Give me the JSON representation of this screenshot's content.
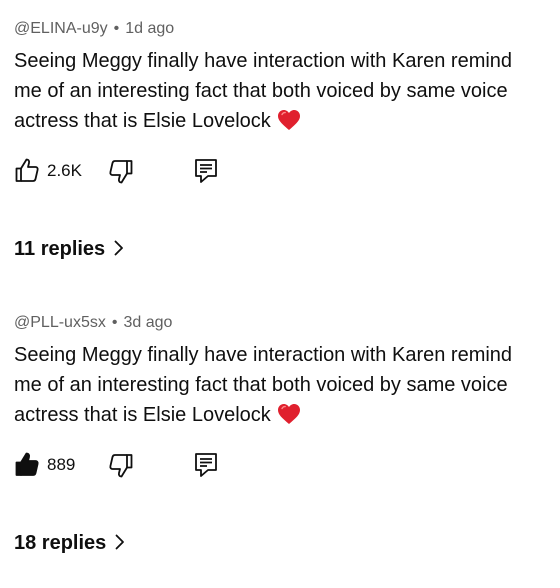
{
  "comments": [
    {
      "author": "@ELINA-u9y",
      "separator": "•",
      "time": "1d ago",
      "text_lines": [
        "Seeing Meggy finally have interaction with Karen remind",
        "me of an interesting fact that both voiced by same voice",
        "actress that is Elsie Lovelock"
      ],
      "emoji": "heart",
      "like_count": "2.6K",
      "liked": false,
      "replies_label": "11 replies"
    },
    {
      "author": "@PLL-ux5sx",
      "separator": "•",
      "time": "3d ago",
      "text_lines": [
        "Seeing Meggy finally have interaction with Karen remind",
        "me of an interesting fact that both voiced by same voice",
        "actress that is Elsie Lovelock"
      ],
      "emoji": "heart",
      "like_count": "889",
      "liked": true,
      "replies_label": "18 replies"
    }
  ],
  "colors": {
    "text": "#0f0f0f",
    "meta": "#606060",
    "heart": "#e0202e"
  },
  "icons": [
    "thumbs-up-icon",
    "thumbs-down-icon",
    "comment-reply-icon",
    "chevron-right-icon",
    "red-heart-emoji"
  ]
}
